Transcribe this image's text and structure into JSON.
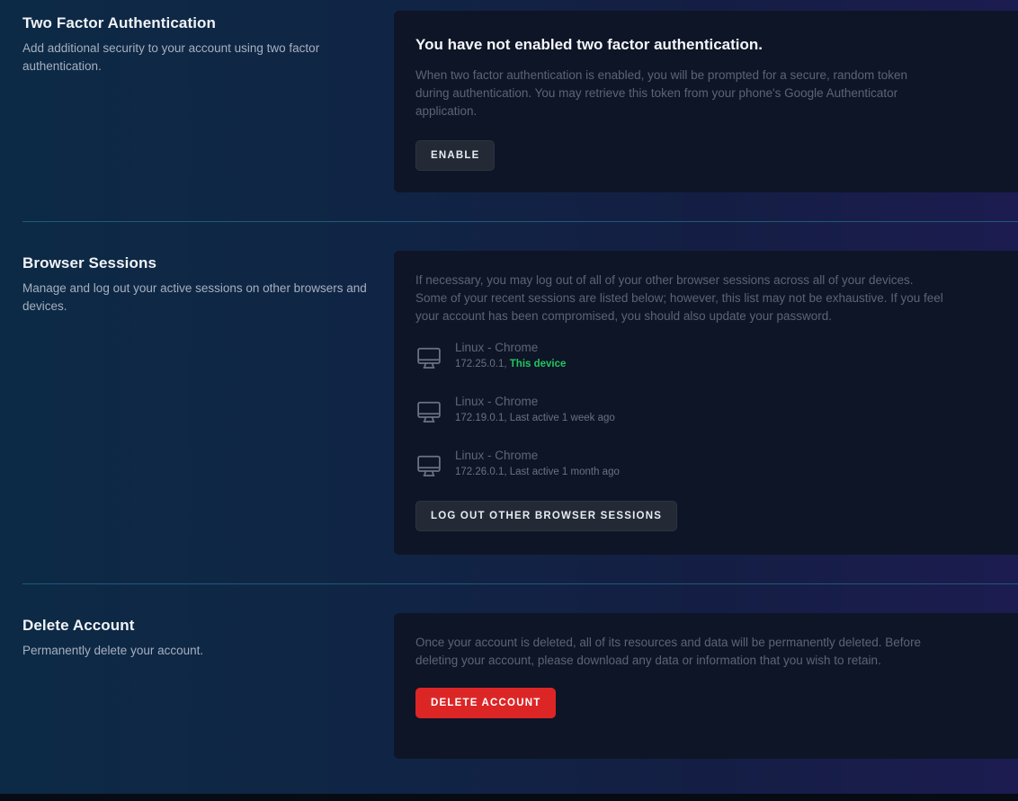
{
  "two_factor": {
    "title": "Two Factor Authentication",
    "description": "Add additional security to your account using two factor authentication.",
    "heading": "You have not enabled two factor authentication.",
    "text": "When two factor authentication is enabled, you will be prompted for a secure, random token during authentication. You may retrieve this token from your phone's Google Authenticator application.",
    "button_label": "Enable"
  },
  "browser_sessions": {
    "title": "Browser Sessions",
    "description": "Manage and log out your active sessions on other browsers and devices.",
    "text": "If necessary, you may log out of all of your other browser sessions across all of your devices. Some of your recent sessions are listed below; however, this list may not be exhaustive. If you feel your account has been compromised, you should also update your password.",
    "sessions": [
      {
        "name": "Linux - Chrome",
        "ip": "172.25.0.1,",
        "status": "This device",
        "icon": "desktop-icon"
      },
      {
        "name": "Linux - Chrome",
        "ip": "172.19.0.1,",
        "status": "Last active 1 week ago",
        "icon": "desktop-icon"
      },
      {
        "name": "Linux - Chrome",
        "ip": "172.26.0.1,",
        "status": "Last active 1 month ago",
        "icon": "desktop-icon"
      }
    ],
    "button_label": "Log Out Other Browser Sessions"
  },
  "delete_account": {
    "title": "Delete Account",
    "description": "Permanently delete your account.",
    "text": "Once your account is deleted, all of its resources and data will be permanently deleted. Before deleting your account, please download any data or information that you wish to retain.",
    "button_label": "Delete Account"
  },
  "colors": {
    "danger": "#dc2626",
    "success": "#22c55e",
    "divider": "#1e5a78",
    "card_bg": "#0e1527"
  }
}
